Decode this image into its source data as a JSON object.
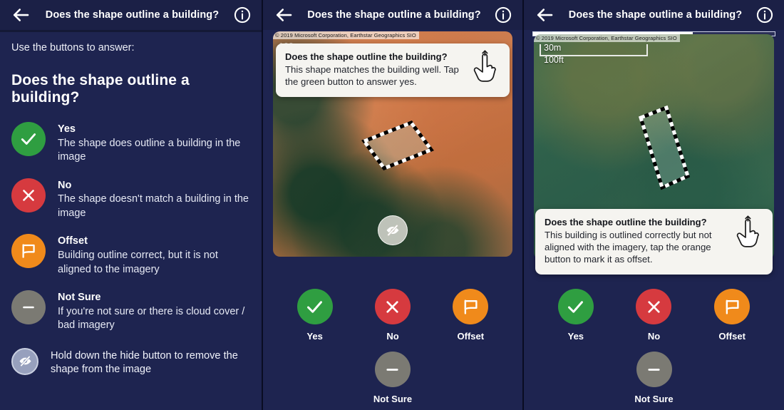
{
  "app": {
    "header": {
      "title": "Does the shape outline a building?",
      "back_icon": "arrow-left-icon",
      "info_icon": "info-circle-icon"
    },
    "colors": {
      "background": "#1e2450",
      "header": "#1b2046",
      "yes": "#2f9e41",
      "no": "#d63a3f",
      "offset": "#f08a1b",
      "not_sure": "#7b7a73",
      "hide": "#97a0bd",
      "callout_bg": "#f5f4f0",
      "progress_fill": "#ffffff"
    }
  },
  "help_panel": {
    "lead": "Use the buttons to answer:",
    "question": "Does the shape outline a building?",
    "options": [
      {
        "label": "Yes",
        "description": "The shape does outline a building in the image",
        "icon": "check-icon",
        "color": "#2f9e41"
      },
      {
        "label": "No",
        "description": "The shape doesn't match a building in the image",
        "icon": "cross-icon",
        "color": "#d63a3f"
      },
      {
        "label": "Offset",
        "description": "Building outline correct, but it is not aligned to the imagery",
        "icon": "flag-icon",
        "color": "#f08a1b"
      },
      {
        "label": "Not Sure",
        "description": "If you're not sure or there is cloud cover / bad imagery",
        "icon": "minus-icon",
        "color": "#7b7a73"
      }
    ],
    "hide_hint": {
      "icon": "eye-slash-icon",
      "text": "Hold down the hide button to remove the shape from the image"
    }
  },
  "task_yes": {
    "map": {
      "attribution": "© 2019 Microsoft Corporation, Earthstar Geographics SIO",
      "scale_metric": "100m",
      "scale_imperial": "",
      "shape": "building-outline-polygon"
    },
    "hide_button_icon": "eye-slash-icon",
    "callout": {
      "title": "Does the shape outline the building?",
      "body": "This shape matches the building well. Tap the green button to answer yes.",
      "icon": "tap-hand-icon"
    },
    "answers": [
      {
        "label": "Yes",
        "icon": "check-icon",
        "color": "#2f9e41"
      },
      {
        "label": "No",
        "icon": "cross-icon",
        "color": "#d63a3f"
      },
      {
        "label": "Offset",
        "icon": "flag-icon",
        "color": "#f08a1b"
      },
      {
        "label": "Not Sure",
        "icon": "minus-icon",
        "color": "#7b7a73"
      }
    ]
  },
  "task_offset": {
    "progress_percent": 66,
    "map": {
      "attribution": "© 2019 Microsoft Corporation, Earthstar Geographics SIO",
      "scale_metric": "30m",
      "scale_imperial": "100ft",
      "shape": "building-outline-polygon"
    },
    "callout": {
      "title": "Does the shape outline the building?",
      "body": "This building is outlined correctly but not aligned with the imagery, tap the orange button to mark it as offset.",
      "icon": "tap-hand-icon"
    },
    "answers": [
      {
        "label": "Yes",
        "icon": "check-icon",
        "color": "#2f9e41"
      },
      {
        "label": "No",
        "icon": "cross-icon",
        "color": "#d63a3f"
      },
      {
        "label": "Offset",
        "icon": "flag-icon",
        "color": "#f08a1b"
      },
      {
        "label": "Not Sure",
        "icon": "minus-icon",
        "color": "#7b7a73"
      }
    ]
  }
}
